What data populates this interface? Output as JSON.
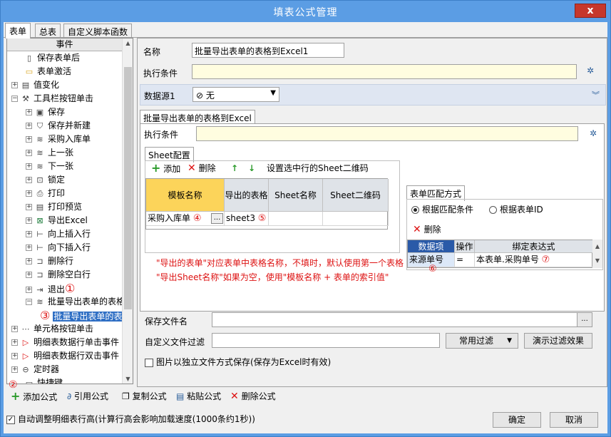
{
  "window": {
    "title": "填表公式管理",
    "close": "x"
  },
  "tabs": [
    "表单",
    "总表",
    "自定义脚本函数"
  ],
  "sidebar": {
    "header": "事件",
    "items": [
      {
        "label": "保存表单后",
        "icon": "save-after-icon"
      },
      {
        "label": "表单激活",
        "icon": "folder-icon"
      },
      {
        "label": "值变化",
        "icon": "value-change-icon"
      },
      {
        "label": "工具栏按钮单击",
        "icon": "wrench-icon"
      },
      {
        "label": "保存",
        "icon": "save-icon"
      },
      {
        "label": "保存并新建",
        "icon": "save-new-icon"
      },
      {
        "label": "采购入库单",
        "icon": "layers-icon"
      },
      {
        "label": "上一张",
        "icon": "layers-icon"
      },
      {
        "label": "下一张",
        "icon": "layers-icon"
      },
      {
        "label": "锁定",
        "icon": "lock-icon"
      },
      {
        "label": "打印",
        "icon": "print-icon"
      },
      {
        "label": "打印预览",
        "icon": "print-preview-icon"
      },
      {
        "label": "导出Excel",
        "icon": "excel-icon"
      },
      {
        "label": "向上插入行",
        "icon": "insert-up-icon"
      },
      {
        "label": "向下插入行",
        "icon": "insert-down-icon"
      },
      {
        "label": "删除行",
        "icon": "delete-row-icon"
      },
      {
        "label": "删除空白行",
        "icon": "delete-blank-row-icon"
      },
      {
        "label": "退出",
        "icon": "exit-icon"
      },
      {
        "label": "批量导出表单的表格",
        "icon": "layers-icon"
      },
      {
        "label": "批量导出表单的表",
        "icon": "none"
      },
      {
        "label": "单元格按钮单击",
        "icon": "dots-icon"
      },
      {
        "label": "明细表数据行单击事件",
        "icon": "flag-icon"
      },
      {
        "label": "明细表数据行双击事件",
        "icon": "flag-icon"
      },
      {
        "label": "定时器",
        "icon": "timer-icon"
      },
      {
        "label": "快捷键",
        "icon": "keyboard-icon"
      }
    ],
    "markers": {
      "m1": "①",
      "m3": "③"
    }
  },
  "bottom_toolbar": {
    "marker": "②",
    "add": "添加公式",
    "ref": "引用公式",
    "copy": "复制公式",
    "paste": "粘贴公式",
    "delete": "删除公式"
  },
  "form": {
    "name_label": "名称",
    "name_value": "批量导出表单的表格到Excel1",
    "cond_label": "执行条件",
    "cond_value": "",
    "ds_label": "数据源1",
    "ds_value": "无",
    "subtab": "批量导出表单的表格到Excel",
    "subcond_label": "执行条件",
    "sheet_tab": "Sheet配置",
    "sheet_toolbar": {
      "add": "添加",
      "delete": "删除",
      "set_qr": "设置选中行的Sheet二维码"
    },
    "sheet_grid": {
      "headers": [
        "模板名称",
        "导出的表格",
        "Sheet名称",
        "Sheet二维码"
      ],
      "row": [
        "采购入库单",
        "sheet3",
        "",
        ""
      ],
      "ellipsis": "..."
    },
    "markers": {
      "m4": "④",
      "m5": "⑤",
      "m6": "⑥",
      "m7": "⑦"
    },
    "match_tab": "表单匹配方式",
    "match_options": [
      "根据匹配条件",
      "根据表单ID"
    ],
    "match_delete": "删除",
    "match_grid": {
      "headers": [
        "数据项",
        "操作",
        "绑定表达式"
      ],
      "row": [
        "来源单号",
        "=",
        "本表单.采购单号"
      ]
    },
    "notes": [
      "\"导出的表单\"对应表单中表格名称，不填时，默认使用第一个表格",
      "\"导出Sheet名称\"如果为空，使用\"模板名称 + 表单的索引值\""
    ],
    "save_file_label": "保存文件名",
    "save_file_value": "",
    "file_filter_label": "自定义文件过滤",
    "file_filter_value": "",
    "filter_select": "常用过滤",
    "demo_filter_button": "演示过滤效果",
    "image_checkbox_label": "图片以独立文件方式保存(保存为Excel时有效)"
  },
  "footer": {
    "auto_adjust_label": "自动调整明细表行高(计算行高会影响加载速度(1000条约1秒))",
    "auto_adjust_checked": true,
    "ok": "确定",
    "cancel": "取消"
  }
}
